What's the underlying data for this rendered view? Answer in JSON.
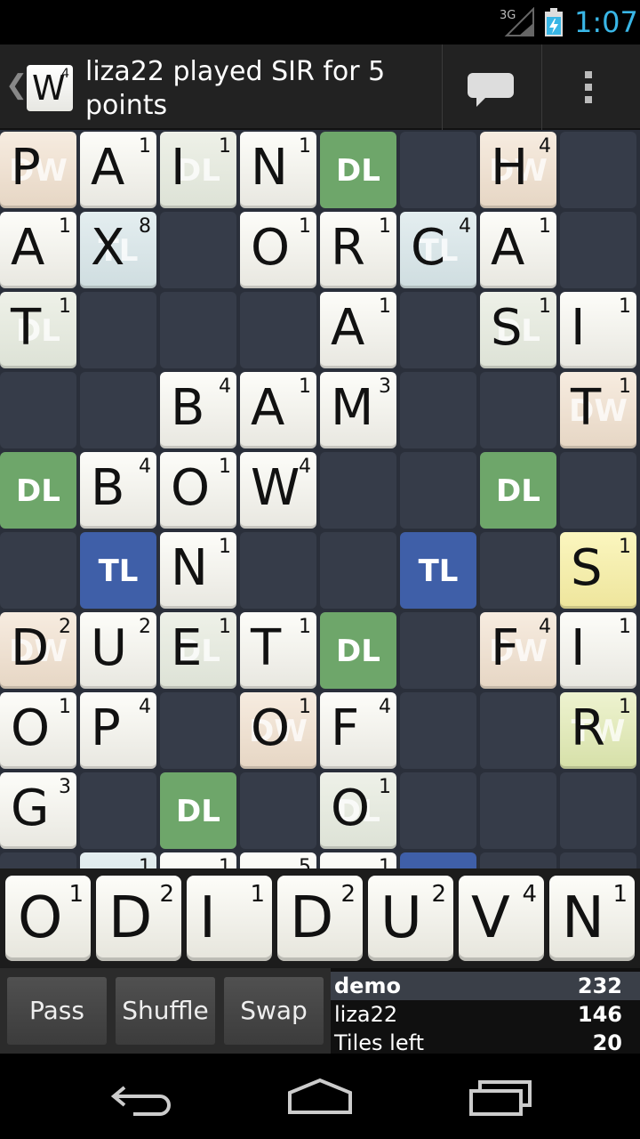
{
  "status_bar": {
    "network": "3G",
    "time": "1:07"
  },
  "action_bar": {
    "logo_letter": "W",
    "logo_score": "4",
    "title": "liza22 played SIR for 5 points"
  },
  "board": {
    "rows": [
      [
        {
          "l": "P",
          "s": "",
          "b": "DW"
        },
        {
          "l": "A",
          "s": "1",
          "b": ""
        },
        {
          "l": "I",
          "s": "1",
          "b": "DL"
        },
        {
          "l": "N",
          "s": "1",
          "b": ""
        },
        {
          "l": "",
          "s": "",
          "b": "DL"
        },
        {
          "l": "",
          "s": "",
          "b": ""
        },
        {
          "l": "H",
          "s": "4",
          "b": "DW"
        },
        {
          "l": "",
          "s": "",
          "b": ""
        }
      ],
      [
        {
          "l": "A",
          "s": "1",
          "b": ""
        },
        {
          "l": "X",
          "s": "8",
          "b": "TL"
        },
        {
          "l": "",
          "s": "",
          "b": ""
        },
        {
          "l": "O",
          "s": "1",
          "b": ""
        },
        {
          "l": "R",
          "s": "1",
          "b": ""
        },
        {
          "l": "C",
          "s": "4",
          "b": "TL"
        },
        {
          "l": "A",
          "s": "1",
          "b": ""
        },
        {
          "l": "",
          "s": "",
          "b": ""
        }
      ],
      [
        {
          "l": "T",
          "s": "1",
          "b": "DL"
        },
        {
          "l": "",
          "s": "",
          "b": ""
        },
        {
          "l": "",
          "s": "",
          "b": ""
        },
        {
          "l": "",
          "s": "",
          "b": ""
        },
        {
          "l": "A",
          "s": "1",
          "b": ""
        },
        {
          "l": "",
          "s": "",
          "b": ""
        },
        {
          "l": "S",
          "s": "1",
          "b": "DL"
        },
        {
          "l": "I",
          "s": "1",
          "b": ""
        }
      ],
      [
        {
          "l": "",
          "s": "",
          "b": ""
        },
        {
          "l": "",
          "s": "",
          "b": ""
        },
        {
          "l": "B",
          "s": "4",
          "b": ""
        },
        {
          "l": "A",
          "s": "1",
          "b": ""
        },
        {
          "l": "M",
          "s": "3",
          "b": ""
        },
        {
          "l": "",
          "s": "",
          "b": ""
        },
        {
          "l": "",
          "s": "",
          "b": ""
        },
        {
          "l": "T",
          "s": "1",
          "b": "DW"
        }
      ],
      [
        {
          "l": "",
          "s": "",
          "b": "DL"
        },
        {
          "l": "B",
          "s": "4",
          "b": ""
        },
        {
          "l": "O",
          "s": "1",
          "b": ""
        },
        {
          "l": "W",
          "s": "4",
          "b": ""
        },
        {
          "l": "",
          "s": "",
          "b": ""
        },
        {
          "l": "",
          "s": "",
          "b": ""
        },
        {
          "l": "",
          "s": "",
          "b": "DL"
        },
        {
          "l": "",
          "s": "",
          "b": ""
        }
      ],
      [
        {
          "l": "",
          "s": "",
          "b": ""
        },
        {
          "l": "",
          "s": "",
          "b": "TL"
        },
        {
          "l": "N",
          "s": "1",
          "b": ""
        },
        {
          "l": "",
          "s": "",
          "b": ""
        },
        {
          "l": "",
          "s": "",
          "b": ""
        },
        {
          "l": "",
          "s": "",
          "b": "TL"
        },
        {
          "l": "",
          "s": "",
          "b": ""
        },
        {
          "l": "S",
          "s": "1",
          "b": "NEW"
        }
      ],
      [
        {
          "l": "D",
          "s": "2",
          "b": "DW"
        },
        {
          "l": "U",
          "s": "2",
          "b": ""
        },
        {
          "l": "E",
          "s": "1",
          "b": "DL"
        },
        {
          "l": "T",
          "s": "1",
          "b": ""
        },
        {
          "l": "",
          "s": "",
          "b": "DL"
        },
        {
          "l": "",
          "s": "",
          "b": ""
        },
        {
          "l": "F",
          "s": "4",
          "b": "DW"
        },
        {
          "l": "I",
          "s": "1",
          "b": ""
        }
      ],
      [
        {
          "l": "O",
          "s": "1",
          "b": ""
        },
        {
          "l": "P",
          "s": "4",
          "b": ""
        },
        {
          "l": "",
          "s": "",
          "b": ""
        },
        {
          "l": "O",
          "s": "1",
          "b": "DW"
        },
        {
          "l": "F",
          "s": "4",
          "b": ""
        },
        {
          "l": "",
          "s": "",
          "b": ""
        },
        {
          "l": "",
          "s": "",
          "b": ""
        },
        {
          "l": "R",
          "s": "1",
          "b": "TW"
        }
      ],
      [
        {
          "l": "G",
          "s": "3",
          "b": ""
        },
        {
          "l": "",
          "s": "",
          "b": ""
        },
        {
          "l": "",
          "s": "",
          "b": "DL"
        },
        {
          "l": "",
          "s": "",
          "b": ""
        },
        {
          "l": "O",
          "s": "1",
          "b": "DL"
        },
        {
          "l": "",
          "s": "",
          "b": ""
        },
        {
          "l": "",
          "s": "",
          "b": ""
        },
        {
          "l": "",
          "s": "",
          "b": ""
        }
      ],
      [
        {
          "l": "",
          "s": "",
          "b": ""
        },
        {
          "l": "",
          "s": "1",
          "b": "TL"
        },
        {
          "l": "",
          "s": "1",
          "b": ""
        },
        {
          "l": "",
          "s": "5",
          "b": ""
        },
        {
          "l": "",
          "s": "1",
          "b": ""
        },
        {
          "l": "",
          "s": "",
          "b": "TL"
        },
        {
          "l": "",
          "s": "",
          "b": ""
        },
        {
          "l": "",
          "s": "",
          "b": ""
        }
      ]
    ]
  },
  "rack": [
    {
      "l": "O",
      "s": "1"
    },
    {
      "l": "D",
      "s": "2"
    },
    {
      "l": "I",
      "s": "1"
    },
    {
      "l": "D",
      "s": "2"
    },
    {
      "l": "U",
      "s": "2"
    },
    {
      "l": "V",
      "s": "4"
    },
    {
      "l": "N",
      "s": "1"
    }
  ],
  "controls": {
    "pass": "Pass",
    "shuffle": "Shuffle",
    "swap": "Swap"
  },
  "scores": [
    {
      "name": "demo",
      "value": "232",
      "active": true
    },
    {
      "name": "liza22",
      "value": "146",
      "active": false
    },
    {
      "name": "Tiles left",
      "value": "20",
      "active": false
    }
  ],
  "colors": {
    "clock": "#39b6e6",
    "DL": "#6ea66a",
    "TL": "#3f5fa8",
    "DW": "#a07050"
  }
}
